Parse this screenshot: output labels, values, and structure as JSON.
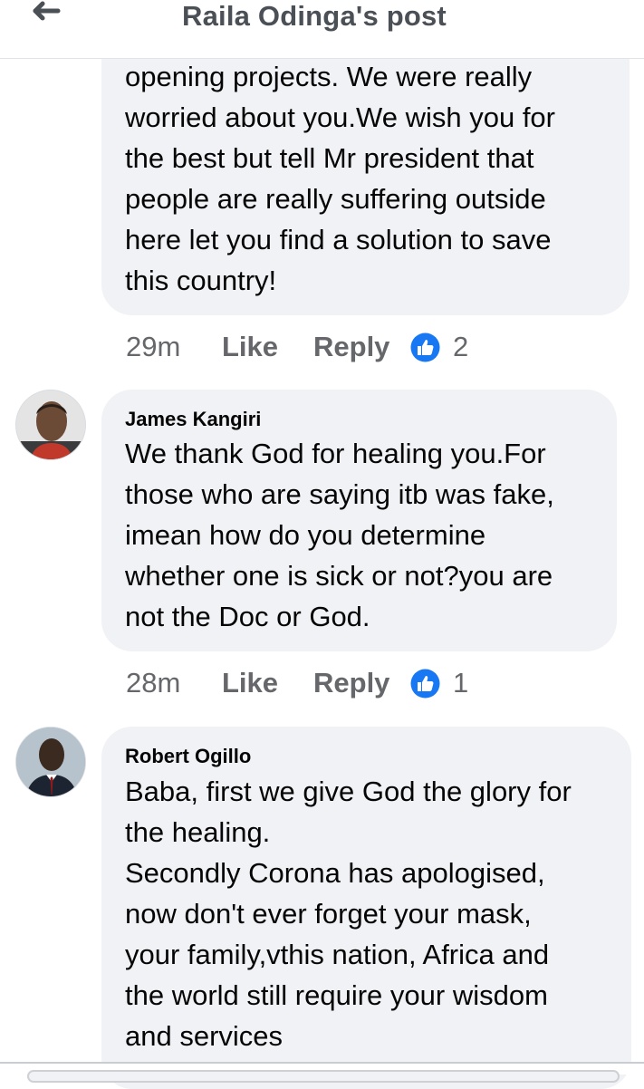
{
  "header": {
    "title": "Raila Odinga's post",
    "back_icon": "arrow-left-icon"
  },
  "comments": [
    {
      "author": "",
      "text": "opening projects. We were really\nworried about you.We wish you for\nthe best but tell Mr president that\npeople are really suffering outside\nhere let you find a solution to save\nthis country!",
      "time": "29m",
      "like_label": "Like",
      "reply_label": "Reply",
      "reaction_icon": "thumbs-up-icon",
      "reaction_count": "2"
    },
    {
      "author": "James Kangiri",
      "text": "We thank God for healing you.For\nthose who are saying itb was fake,\nimean how do you determine\nwhether one is sick or not?you are\nnot the Doc or God.",
      "time": "28m",
      "like_label": "Like",
      "reply_label": "Reply",
      "reaction_icon": "thumbs-up-icon",
      "reaction_count": "1"
    },
    {
      "author": "Robert Ogillo",
      "text": "Baba, first we give God the glory for\nthe healing.\nSecondly Corona has apologised,\nnow don't ever forget your mask,\nyour family,vthis nation, Africa and\nthe world still require your wisdom\nand services"
    }
  ],
  "colors": {
    "bubble": "#f0f2f5",
    "meta_text": "#65676b",
    "like_blue": "#1877f2"
  }
}
